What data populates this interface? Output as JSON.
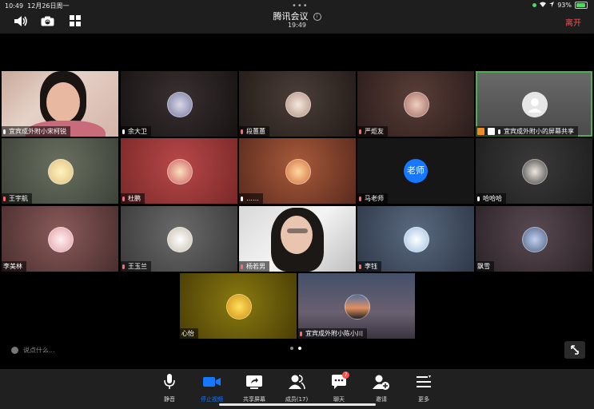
{
  "status": {
    "time": "10:49",
    "date": "12月26日周一",
    "battery": "93%"
  },
  "header": {
    "title": "腾讯会议",
    "duration": "19:49",
    "leave_label": "离开"
  },
  "participants": [
    {
      "name": "宜宾成外附小宋柯锐"
    },
    {
      "name": "余大卫"
    },
    {
      "name": "段蕙蕙"
    },
    {
      "name": "严炬友"
    },
    {
      "name": "宜宾成外附小的屏幕共享"
    },
    {
      "name": "王宇航"
    },
    {
      "name": "杜鹏"
    },
    {
      "name": "……"
    },
    {
      "name": "马老师",
      "avatar_text": "老师"
    },
    {
      "name": "哈哈哈"
    },
    {
      "name": "李美林"
    },
    {
      "name": "王玉兰"
    },
    {
      "name": "杨若男"
    },
    {
      "name": "李钰"
    },
    {
      "name": "飘雪"
    },
    {
      "name": "心怡"
    },
    {
      "name": "宜宾成外附小陈小川"
    }
  ],
  "chat": {
    "placeholder": "说点什么..."
  },
  "toolbar": {
    "mute": "静音",
    "stop_video": "停止视频",
    "share_screen": "共享屏幕",
    "members": "成员(17)",
    "chat": "聊天",
    "chat_badge": "7",
    "invite": "邀请",
    "more": "更多"
  },
  "colors": {
    "accent": "#1677ff",
    "leave": "#ff4d4f",
    "active_border": "#4caf50"
  }
}
